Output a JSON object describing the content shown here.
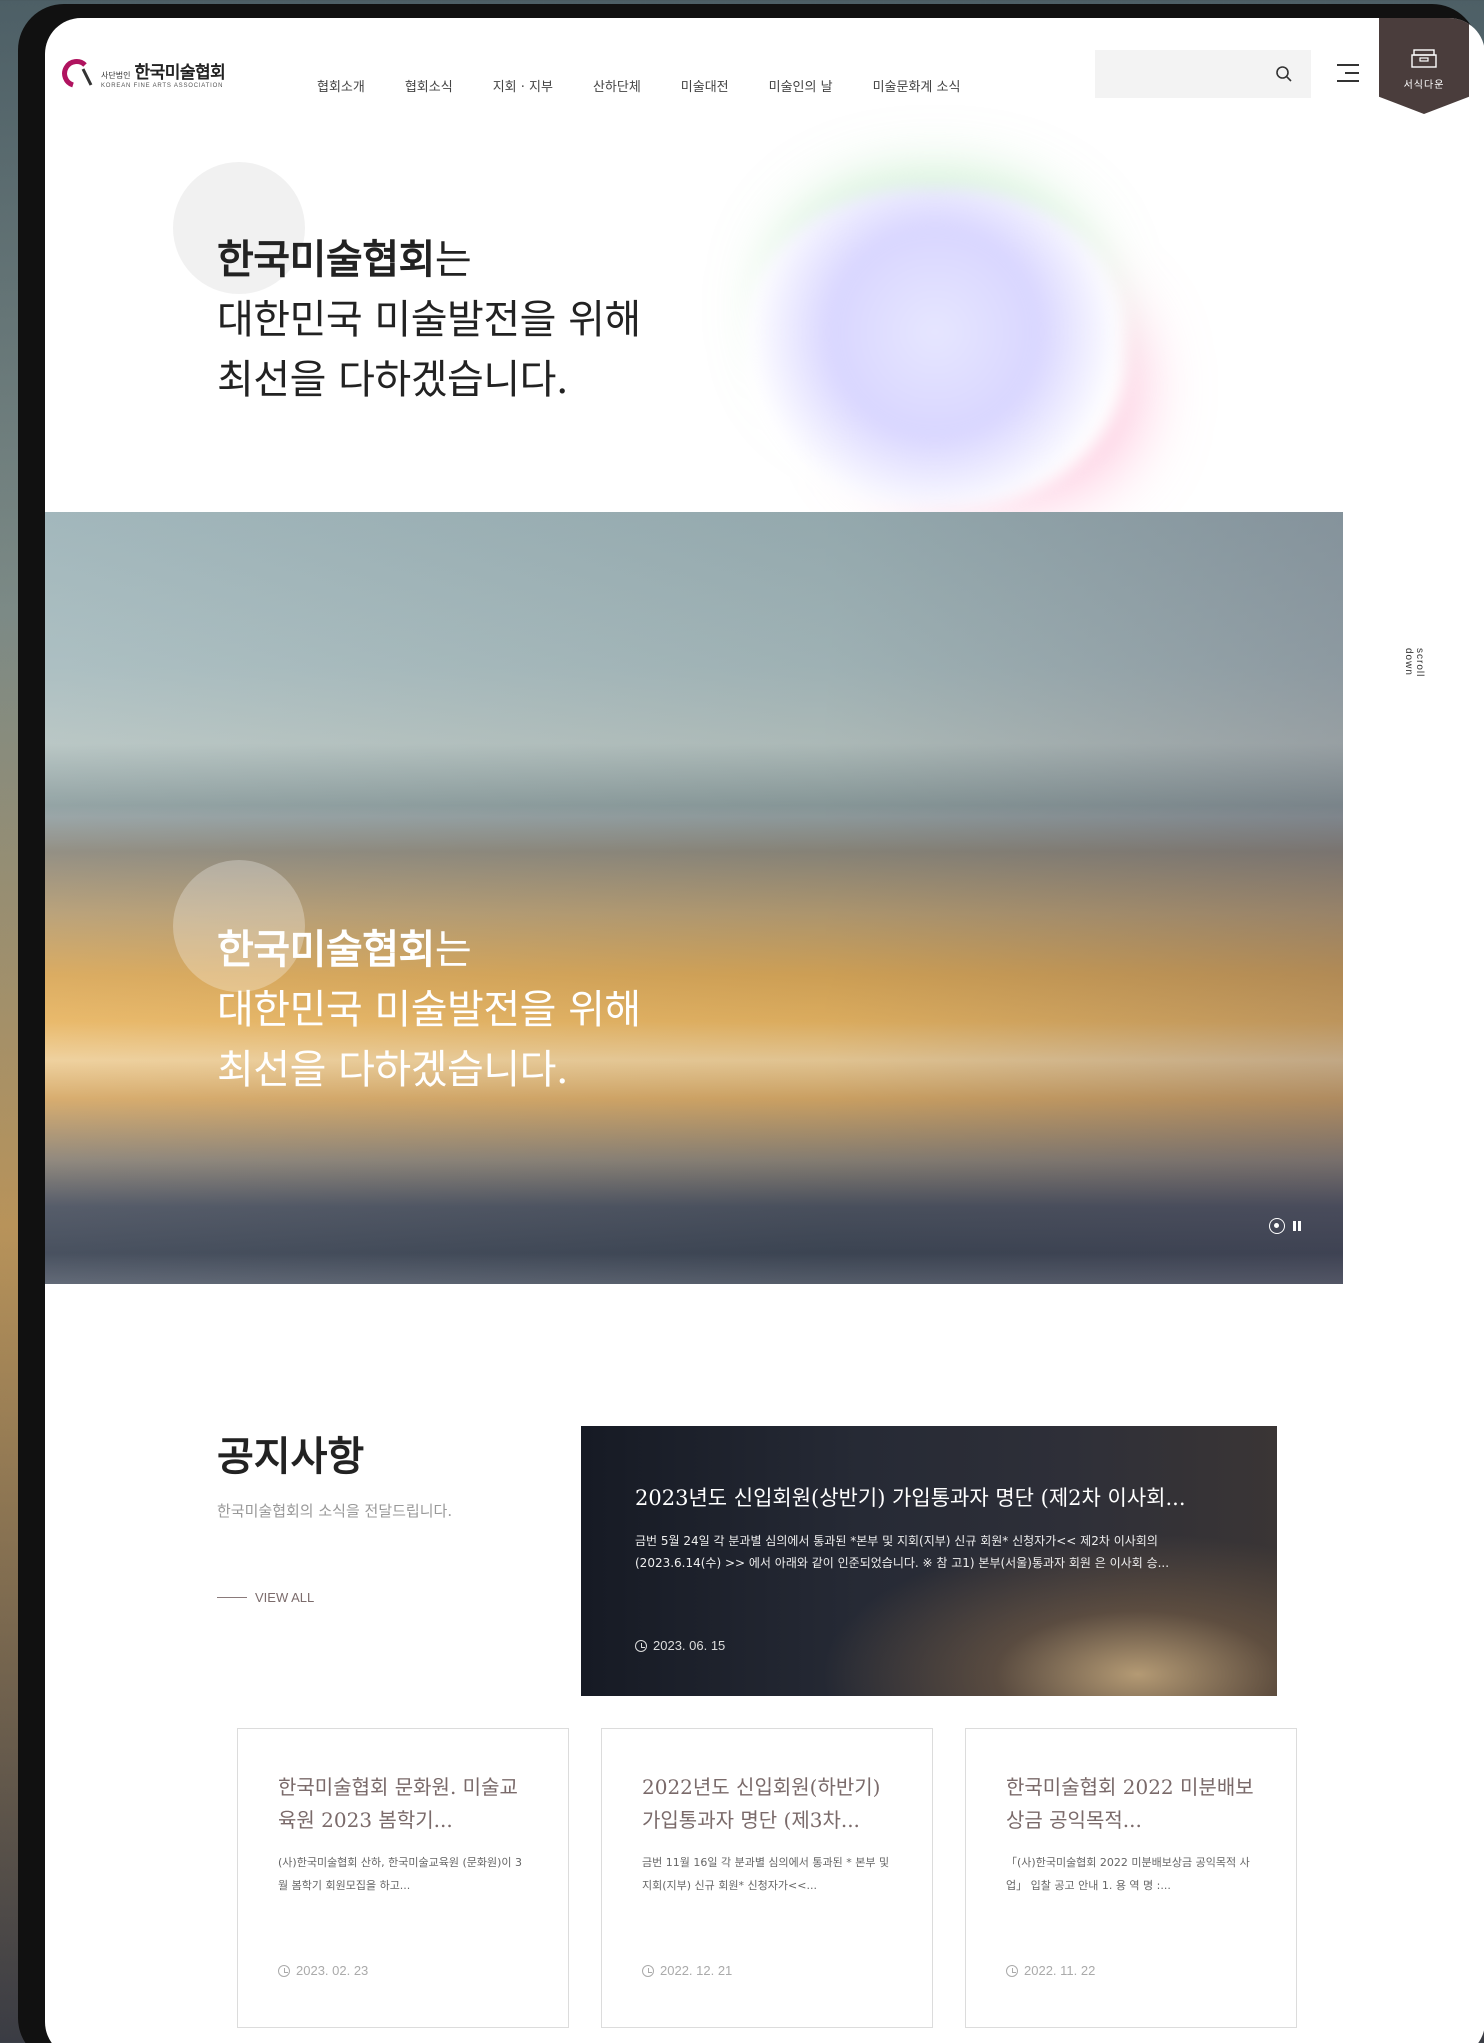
{
  "header": {
    "logo_sub": "사단법인",
    "logo_main": "한국미술협회",
    "logo_en": "KOREAN FINE ARTS ASSOCIATION",
    "nav": [
      "협회소개",
      "협회소식",
      "지회 · 지부",
      "산하단체",
      "미술대전",
      "미술인의 날",
      "미술문화계 소식"
    ],
    "search_placeholder": "",
    "download_label": "서식다운"
  },
  "hero": {
    "headline_bold": "한국미술협회",
    "headline_suffix": "는",
    "headline_line2": "대한민국 미술발전을 위해",
    "headline_line3": "최선을 다하겠습니다.",
    "scroll_label": "scroll down"
  },
  "notice": {
    "title": "공지사항",
    "subtitle": "한국미술협회의 소식을 전달드립니다.",
    "view_all": "VIEW ALL",
    "featured": {
      "title": "2023년도 신입회원(상반기) 가입통과자 명단 (제2차 이사회...",
      "body": "금번 5월 24일 각 분과별 심의에서 통과된 *본부 및 지회(지부) 신규 회원* 신청자가<< 제2차 이사회의 (2023.6.14(수) >> 에서 아래와 같이 인준되었습니다. ※ 참 고1) 본부(서울)통과자 회원 은 이사회 승...",
      "date": "2023. 06. 15"
    },
    "cards": [
      {
        "title": "한국미술협회 문화원. 미술교육원 2023 봄학기...",
        "body": "(사)한국미술협회 산하, 한국미술교육원 (문화원)이 3 월 봄학기 회원모집을 하고...",
        "date": "2023. 02. 23"
      },
      {
        "title": "2022년도 신입회원(하반기) 가입통과자 명단 (제3차...",
        "body": "금번 11월 16일 각 분과별 심의에서 통과된 * 본부 및 지회(지부) 신규 회원* 신청자가<<...",
        "date": "2022. 12. 21"
      },
      {
        "title": "한국미술협회 2022 미분배보상금 공익목적...",
        "body": "「(사)한국미술협회 2022 미분배보상금 공익목적 사업」 입찰 공고 안내 1. 용 역 명 :...",
        "date": "2022. 11. 22"
      }
    ]
  },
  "colors": {
    "brand_dark": "#4a3d3c",
    "logo_magenta": "#b0135f",
    "accent_text": "#7a6a6a"
  }
}
